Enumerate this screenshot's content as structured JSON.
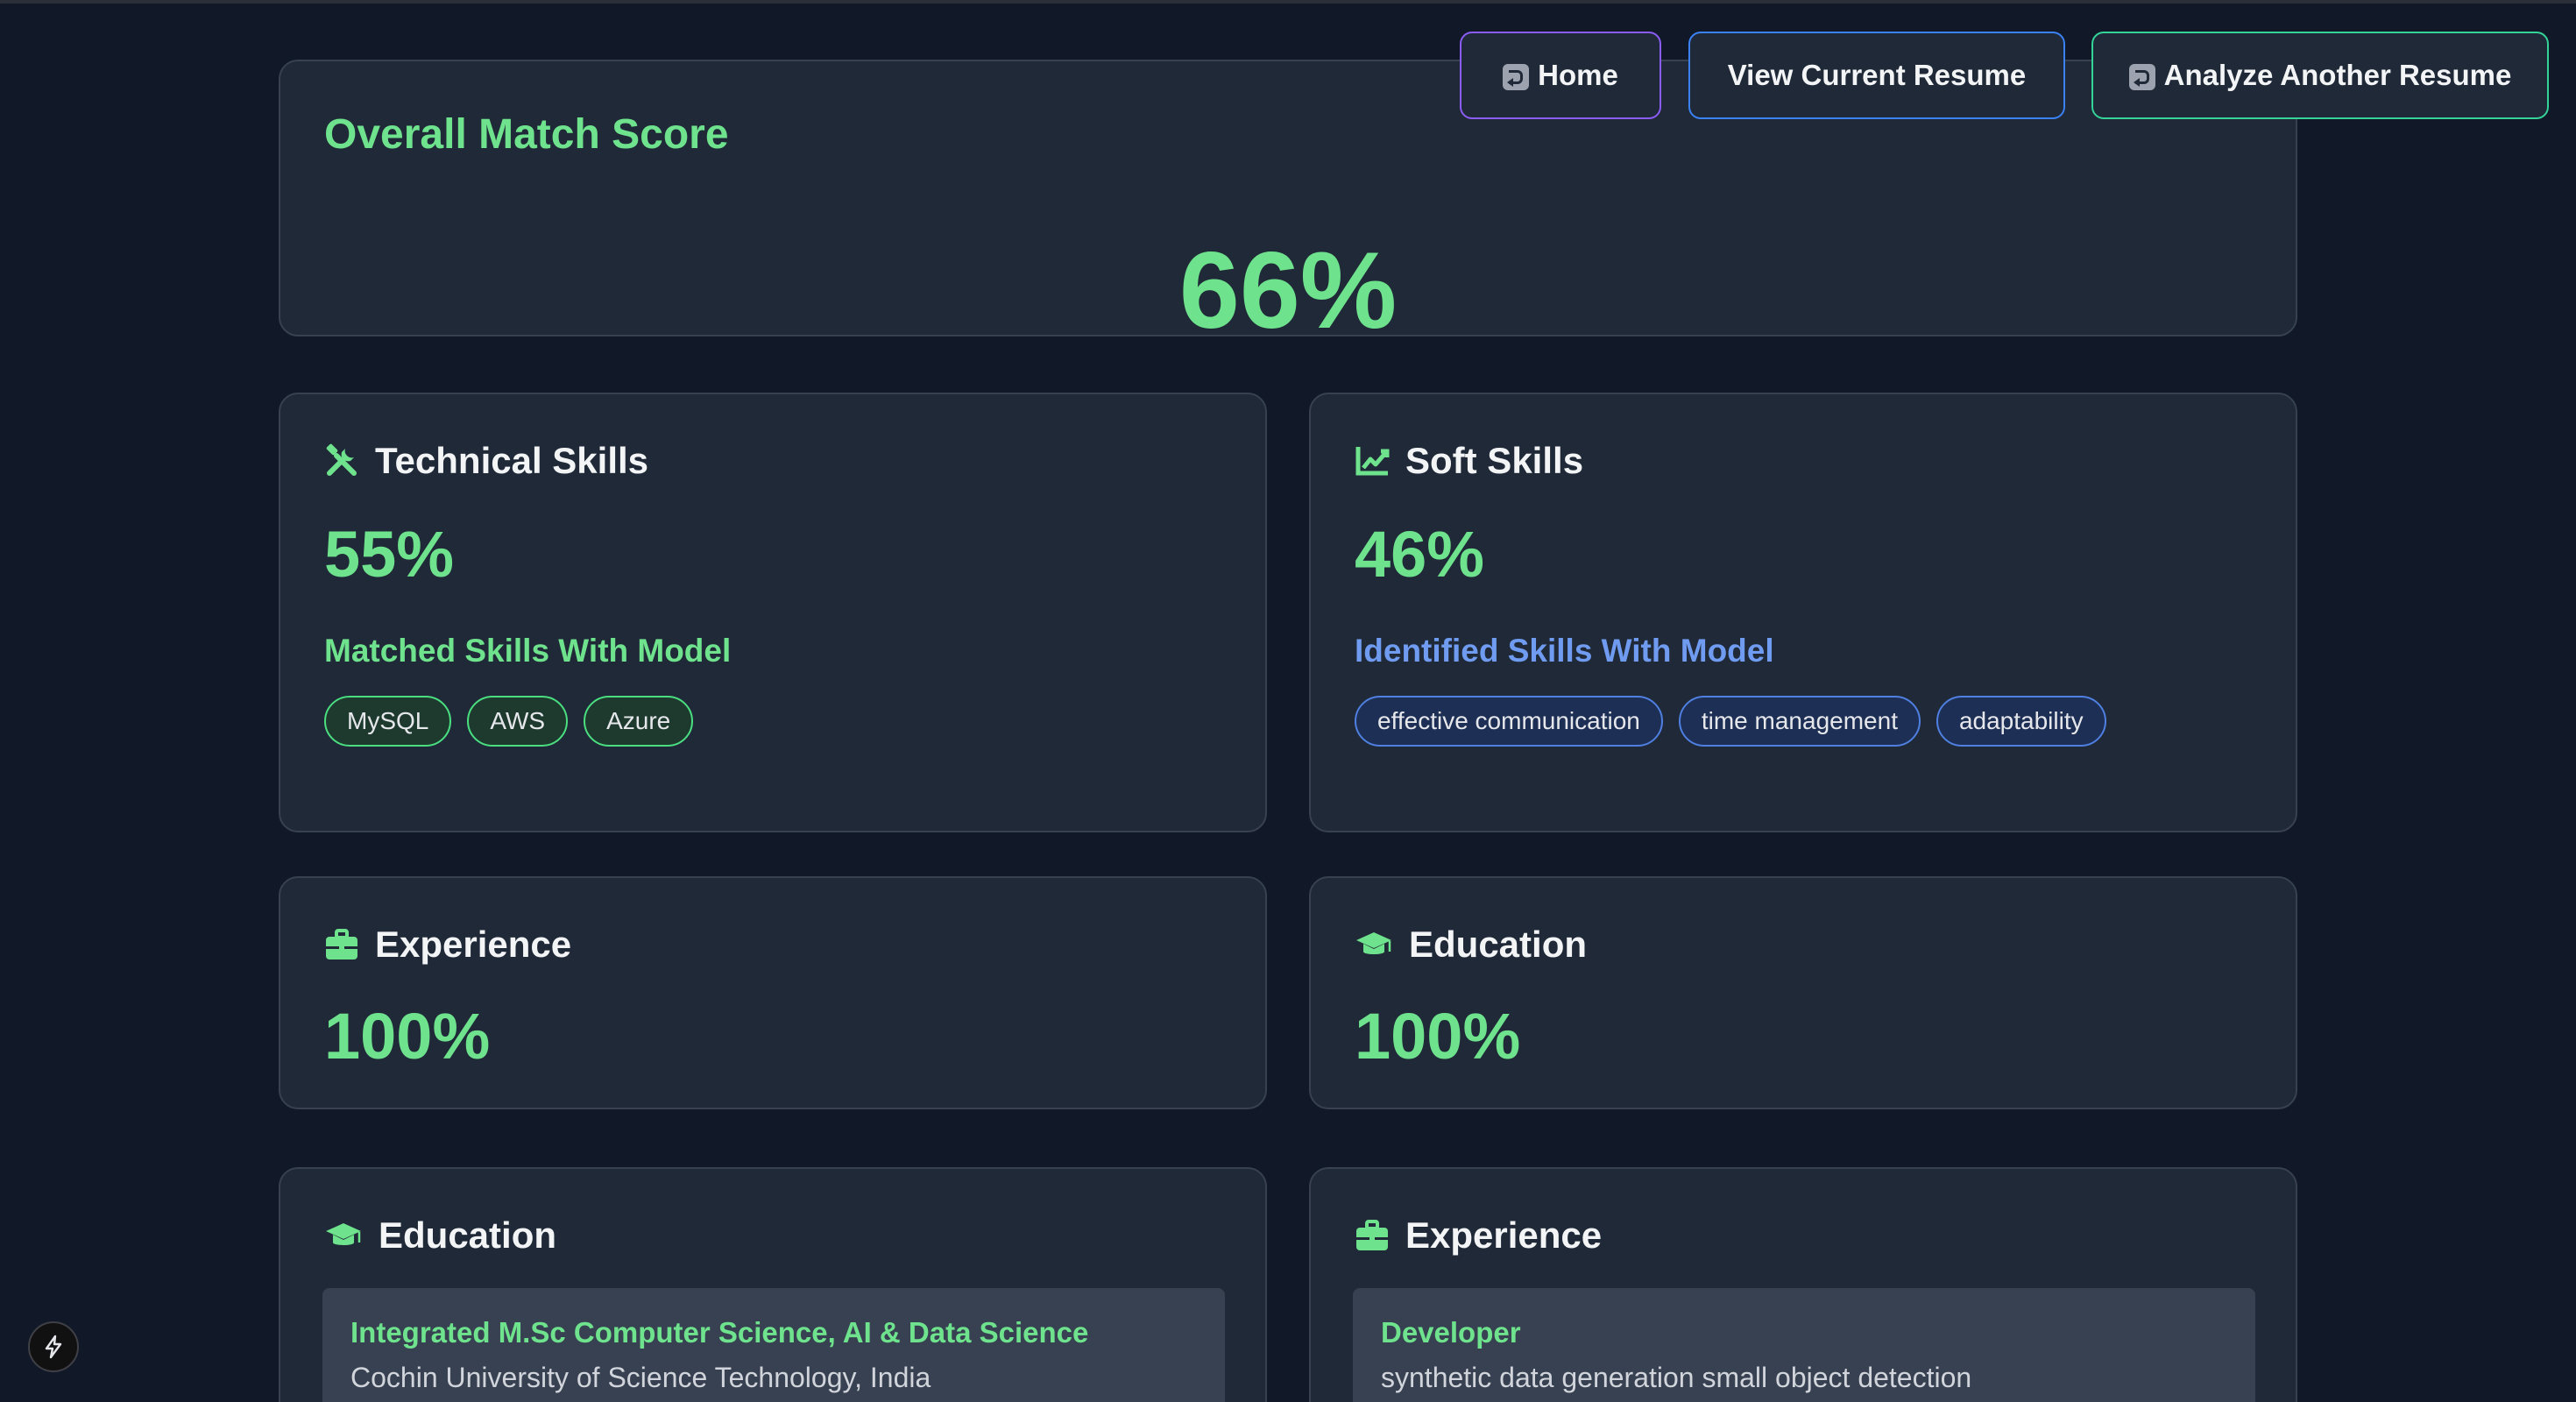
{
  "nav": {
    "home_label": "Home",
    "view_resume_label": "View Current Resume",
    "analyze_label": "Analyze Another Resume"
  },
  "overall": {
    "title": "Overall Match Score",
    "score": "66%"
  },
  "technical": {
    "title": "Technical Skills",
    "score": "55%",
    "subtitle": "Matched Skills With Model",
    "skills": [
      "MySQL",
      "AWS",
      "Azure"
    ]
  },
  "soft": {
    "title": "Soft Skills",
    "score": "46%",
    "subtitle": "Identified Skills With Model",
    "skills": [
      "effective communication",
      "time management",
      "adaptability"
    ]
  },
  "experience_score": {
    "title": "Experience",
    "score": "100%"
  },
  "education_score": {
    "title": "Education",
    "score": "100%"
  },
  "education_detail": {
    "title": "Education",
    "degree": "Integrated M.Sc Computer Science, AI & Data Science",
    "institution": "Cochin University of Science Technology, India"
  },
  "experience_detail": {
    "title": "Experience",
    "role": "Developer",
    "description": "synthetic data generation small object detection"
  },
  "colors": {
    "background": "#111827",
    "card": "#1f2937",
    "accent_green": "#6ee28c",
    "accent_blue": "#6f9bf0",
    "home_border": "#8b5cf6",
    "view_border": "#3b82f6",
    "analyze_border": "#34d399"
  },
  "icons": {
    "nav": "return-icon",
    "technical": "tools-icon",
    "soft": "chart-line-icon",
    "experience": "briefcase-icon",
    "education": "graduation-cap-icon",
    "corner": "lightning-icon"
  }
}
